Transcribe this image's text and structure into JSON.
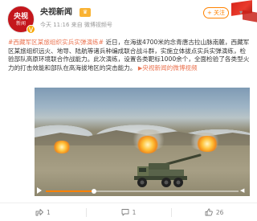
{
  "account": {
    "avatar_line1": "央视",
    "avatar_line2": "新闻",
    "name": "央视新闻",
    "time": "今天 11:16",
    "source_prefix": "来自",
    "source": "微博视频号",
    "follow_label": "+ 关注",
    "verified_mark": "V"
  },
  "post": {
    "hashtag": "#西藏军区某旅组织实兵实弹演练#",
    "text": " 近日，在海拔4700米的念青唐古拉山脉南麓，西藏军区某旅组织远火、地导、陆航等诸兵种编成联合战斗群，实施立体拔点实兵实弹演练，检验部队高原环境联合作战能力。此次演练，设置各类靶标1000余个，全面检验了各类型火力的打击效能和部队在高海拔地区的突击能力。",
    "link_icon": "▶",
    "link_label": "央视新闻的微博视频"
  },
  "video": {
    "progress": 0.25
  },
  "actions": {
    "share": "1",
    "comment": "1",
    "like": "26"
  },
  "colors": {
    "accent": "#ff8200",
    "link": "#eb7350",
    "brand": "#c4161c"
  }
}
